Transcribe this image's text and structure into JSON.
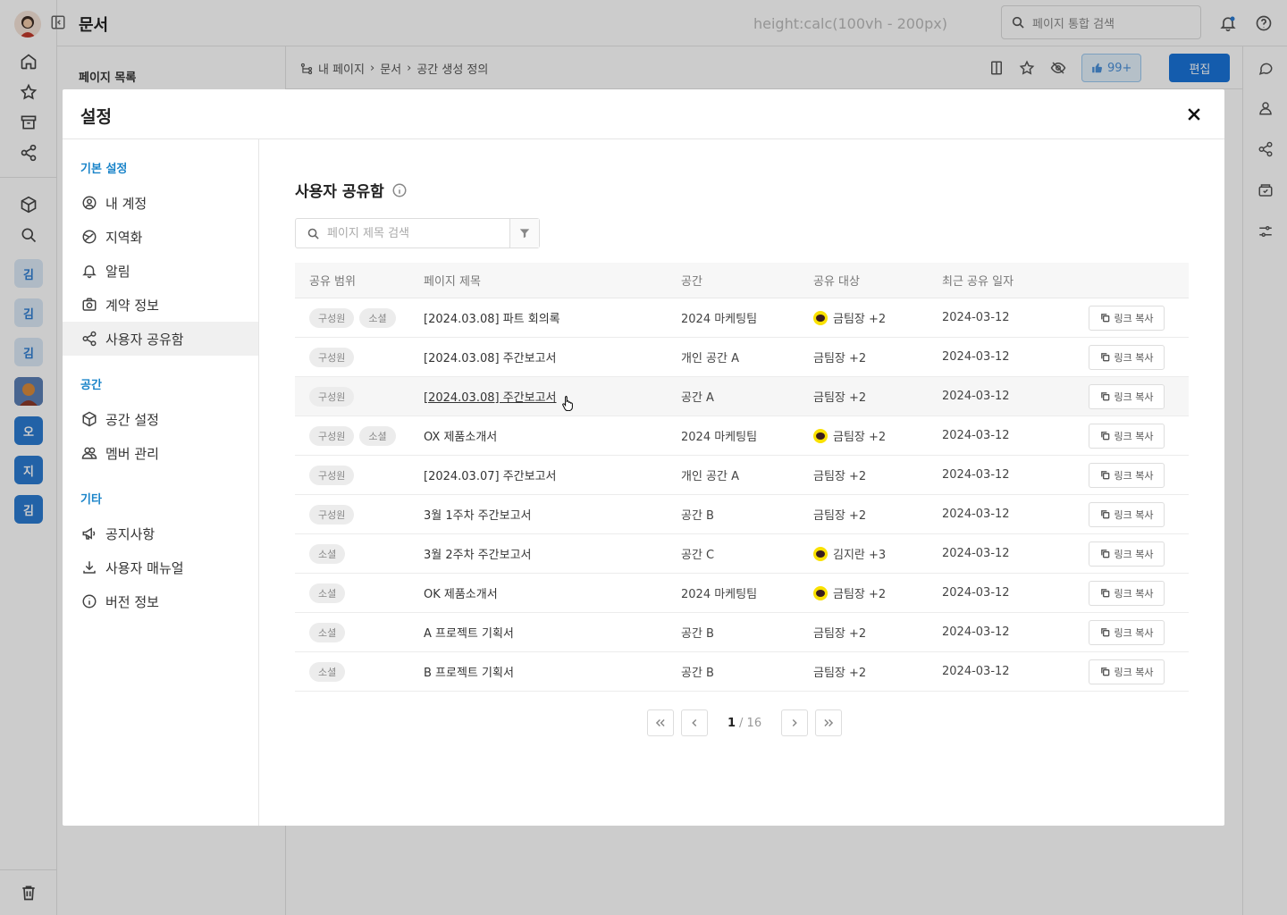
{
  "app": {
    "title": "문서",
    "ghost_text": "height:calc(100vh - 200px)",
    "search_placeholder": "페이지 통합 검색",
    "rail_avatars": [
      "김",
      "김",
      "김",
      "오",
      "지",
      "김"
    ]
  },
  "side_panel": {
    "title": "페이지 목록"
  },
  "breadcrumb": {
    "items": [
      "내 페이지",
      "문서",
      "공간 생성 정의"
    ],
    "like_count": "99+",
    "edit_label": "편집"
  },
  "modal": {
    "title": "설정",
    "nav": {
      "sections": [
        {
          "label": "기본 설정",
          "items": [
            "내 계정",
            "지역화",
            "알림",
            "계약 정보",
            "사용자 공유함"
          ]
        },
        {
          "label": "공간",
          "items": [
            "공간 설정",
            "멤버 관리"
          ]
        },
        {
          "label": "기타",
          "items": [
            "공지사항",
            "사용자 매뉴얼",
            "버전 정보"
          ]
        }
      ]
    },
    "content": {
      "title": "사용자 공유함",
      "search_placeholder": "페이지 제목 검색",
      "columns": [
        "공유 범위",
        "페이지 제목",
        "공간",
        "공유 대상",
        "최근 공유 일자"
      ],
      "copy_label": "링크 복사",
      "rows": [
        {
          "scopes": [
            "구성원",
            "소셜"
          ],
          "title": "[2024.03.08] 파트 회의록",
          "space": "2024 마케팅팀",
          "kakao": true,
          "target": "금팀장 +2",
          "date": "2024-03-12"
        },
        {
          "scopes": [
            "구성원"
          ],
          "title": "[2024.03.08] 주간보고서",
          "space": "개인 공간 A",
          "kakao": false,
          "target": "금팀장 +2",
          "date": "2024-03-12"
        },
        {
          "scopes": [
            "구성원"
          ],
          "title": "[2024.03.08] 주간보고서",
          "space": "공간 A",
          "kakao": false,
          "target": "금팀장 +2",
          "date": "2024-03-12"
        },
        {
          "scopes": [
            "구성원",
            "소셜"
          ],
          "title": "OX 제품소개서",
          "space": "2024 마케팅팀",
          "kakao": true,
          "target": "금팀장 +2",
          "date": "2024-03-12"
        },
        {
          "scopes": [
            "구성원"
          ],
          "title": "[2024.03.07] 주간보고서",
          "space": "개인 공간 A",
          "kakao": false,
          "target": "금팀장 +2",
          "date": "2024-03-12"
        },
        {
          "scopes": [
            "구성원"
          ],
          "title": "3월 1주차 주간보고서",
          "space": "공간 B",
          "kakao": false,
          "target": "금팀장 +2",
          "date": "2024-03-12"
        },
        {
          "scopes": [
            "소셜"
          ],
          "title": "3월 2주차 주간보고서",
          "space": "공간 C",
          "kakao": true,
          "target": "김지란 +3",
          "date": "2024-03-12"
        },
        {
          "scopes": [
            "소셜"
          ],
          "title": "OK 제품소개서",
          "space": "2024 마케팅팀",
          "kakao": true,
          "target": "금팀장 +2",
          "date": "2024-03-12"
        },
        {
          "scopes": [
            "소셜"
          ],
          "title": "A 프로젝트 기획서",
          "space": "공간 B",
          "kakao": false,
          "target": "금팀장 +2",
          "date": "2024-03-12"
        },
        {
          "scopes": [
            "소셜"
          ],
          "title": "B 프로젝트 기획서",
          "space": "공간 B",
          "kakao": false,
          "target": "금팀장 +2",
          "date": "2024-03-12"
        }
      ],
      "pagination": {
        "current": "1",
        "total": "/ 16"
      }
    }
  }
}
